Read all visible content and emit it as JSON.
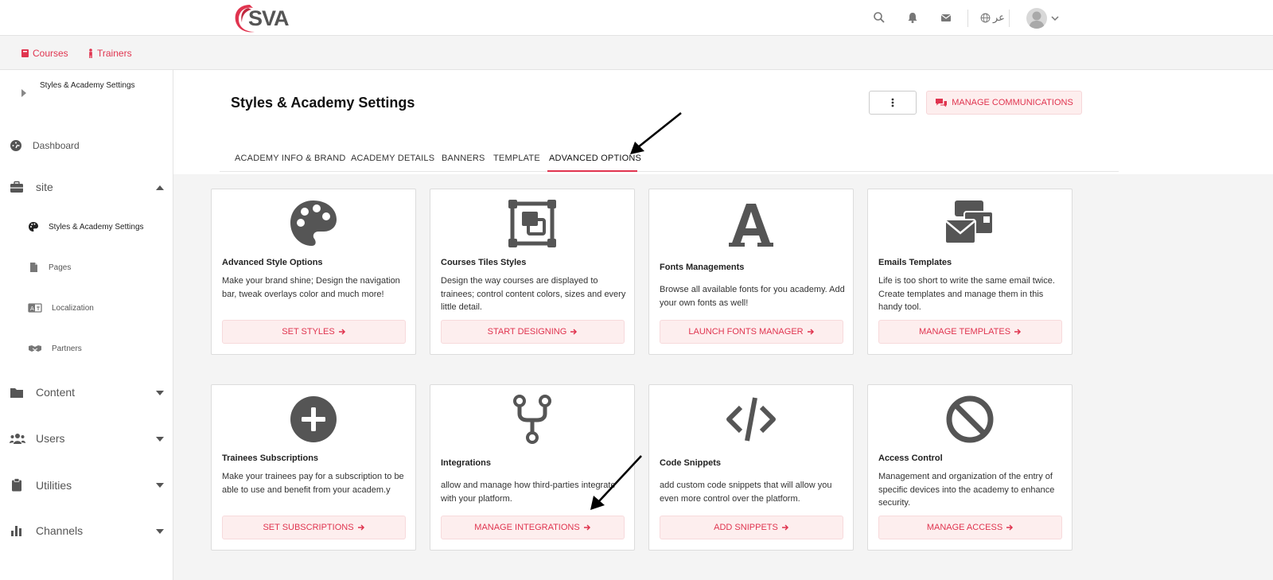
{
  "header": {
    "logo_text": "SVA",
    "lang_label": "عر",
    "icons": [
      "search-icon",
      "bell-icon",
      "mail-icon",
      "globe-icon",
      "avatar",
      "chevron-down-icon"
    ]
  },
  "subnav": {
    "courses": "Courses",
    "trainers": "Trainers"
  },
  "sidebar": {
    "breadcrumb": "Styles & Academy Settings",
    "dashboard": "Dashboard",
    "site": "site",
    "site_children": [
      "Styles & Academy Settings",
      "Pages",
      "Localization",
      "Partners"
    ],
    "content": "Content",
    "users": "Users",
    "utilities": "Utilities",
    "channels": "Channels"
  },
  "main": {
    "title": "Styles & Academy Settings",
    "manage_communications": "MANAGE COMMUNICATIONS",
    "tabs": [
      "ACADEMY INFO & BRAND",
      "ACADEMY DETAILS",
      "BANNERS",
      "TEMPLATE",
      "ADVANCED OPTIONS"
    ],
    "active_tab": "ADVANCED OPTIONS",
    "cards": [
      {
        "icon": "palette-icon",
        "title": "Advanced Style Options",
        "desc": "Make your brand shine; Design the navigation bar, tweak overlays color and much more!",
        "button": "SET STYLES"
      },
      {
        "icon": "vector-square-icon",
        "title": "Courses Tiles Styles",
        "desc": "Design the way courses are displayed to trainees; control content colors, sizes and every little detail.",
        "button": "START DESIGNING"
      },
      {
        "icon": "font-icon",
        "title": "Fonts Managements",
        "desc": "Browse all available fonts for you academy. Add your own fonts as well!",
        "button": "LAUNCH FONTS MANAGER"
      },
      {
        "icon": "envelopes-icon",
        "title": "Emails Templates",
        "desc": "Life is too short to write the same email twice. Create templates and manage them in this handy tool.",
        "button": "MANAGE TEMPLATES"
      },
      {
        "icon": "plus-circle-icon",
        "title": "Trainees Subscriptions",
        "desc": "Make your trainees pay for a subscription to be able to use and benefit from your academ.y",
        "button": "SET SUBSCRIPTIONS"
      },
      {
        "icon": "code-branch-icon",
        "title": "Integrations",
        "desc": "allow and manage how third-parties integrate with your platform.",
        "button": "MANAGE INTEGRATIONS"
      },
      {
        "icon": "code-icon",
        "title": "Code Snippets",
        "desc": "add custom code snippets that will allow you even more control over the platform.",
        "button": "ADD SNIPPETS"
      },
      {
        "icon": "ban-icon",
        "title": "Access Control",
        "desc": "Management and organization of the entry of specific devices into the academy to enhance security.",
        "button": "MANAGE ACCESS"
      }
    ]
  },
  "colors": {
    "accent": "#e0344f",
    "button_bg": "#fdeeee",
    "icon_gray": "#555555",
    "content_bg": "#f4f4f4"
  }
}
